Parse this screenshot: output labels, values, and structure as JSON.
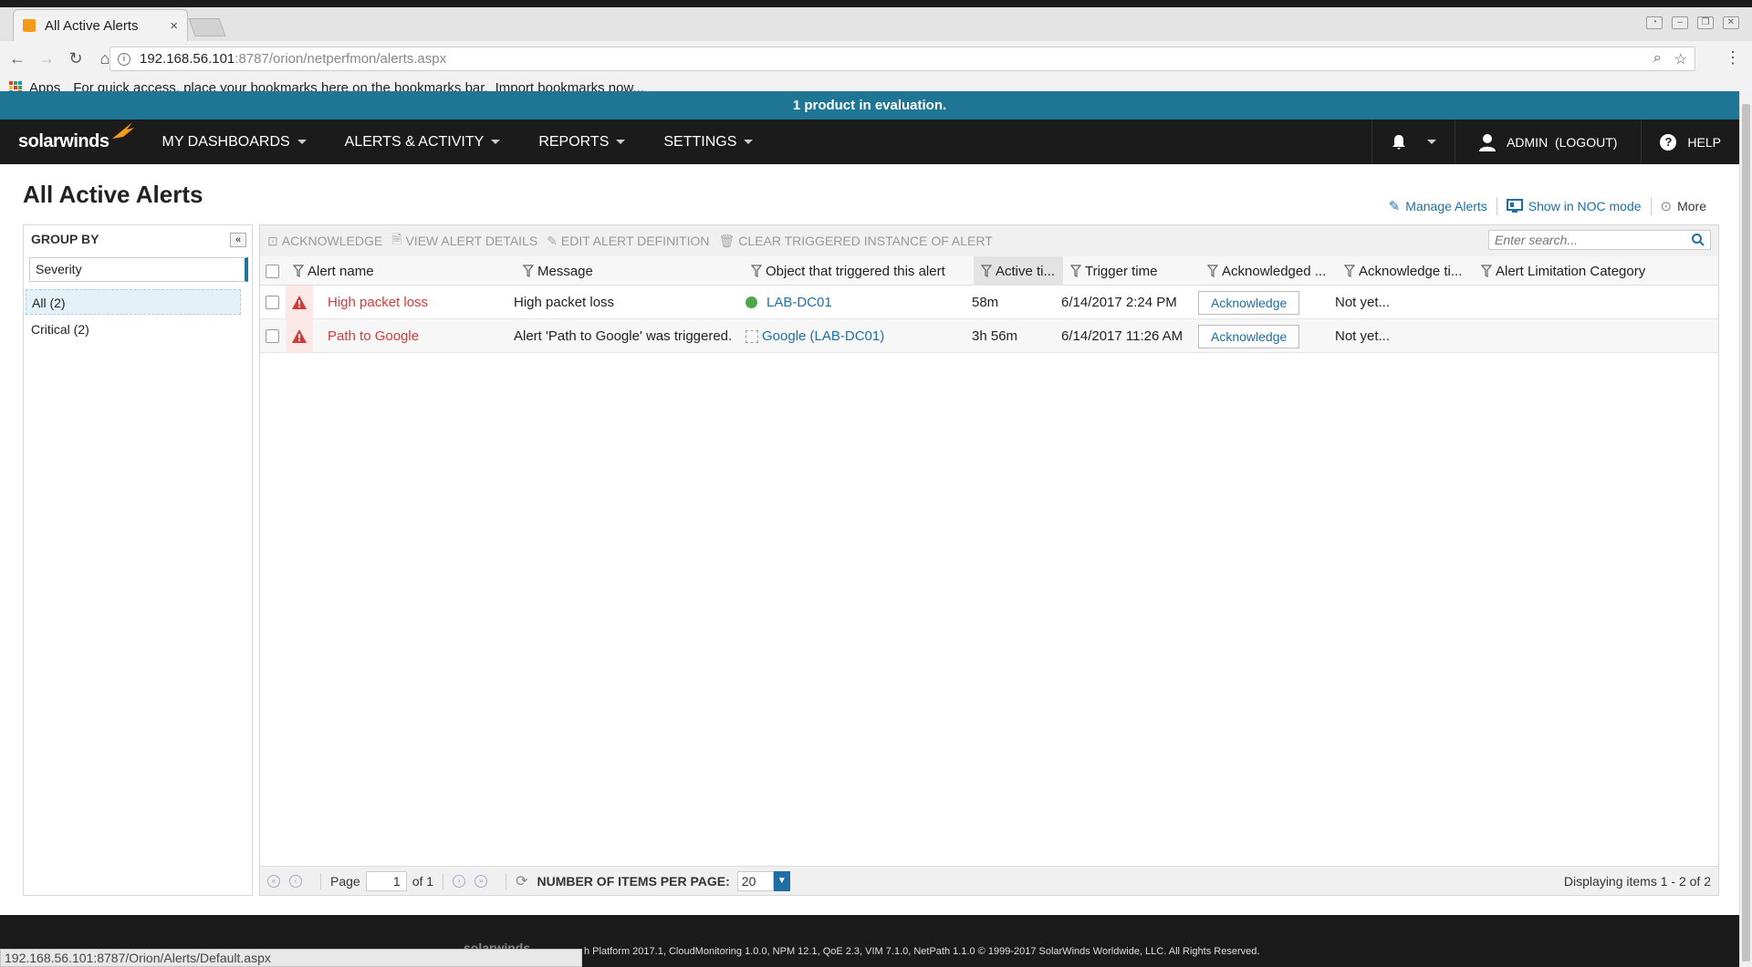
{
  "browser": {
    "tab_title": "All Active Alerts",
    "tab_close": "×",
    "url_host": "192.168.56.101",
    "url_path": ":8787/orion/netperfmon/alerts.aspx",
    "bookmarks_apps": "Apps",
    "bookmarks_hint": "For quick access, place your bookmarks here on the bookmarks bar.",
    "bookmarks_import": "Import bookmarks now...",
    "status_url": "192.168.56.101:8787/Orion/Alerts/Default.aspx"
  },
  "eval_banner": "1 product in evaluation.",
  "nav": {
    "logo": "solarwinds",
    "items": [
      {
        "label": "MY DASHBOARDS"
      },
      {
        "label": "ALERTS & ACTIVITY"
      },
      {
        "label": "REPORTS"
      },
      {
        "label": "SETTINGS"
      }
    ],
    "user": "ADMIN",
    "logout": "(LOGOUT)",
    "help": "HELP"
  },
  "page": {
    "title": "All Active Alerts",
    "actions": {
      "manage": "Manage Alerts",
      "noc": "Show in NOC mode",
      "more": "More"
    }
  },
  "groupby": {
    "title": "GROUP BY",
    "selected": "Severity",
    "items": [
      {
        "label": "All (2)"
      },
      {
        "label": "Critical (2)"
      }
    ]
  },
  "toolbar": {
    "acknowledge": "ACKNOWLEDGE",
    "view_details": "VIEW ALERT DETAILS",
    "edit_definition": "EDIT ALERT DEFINITION",
    "clear_instance": "CLEAR TRIGGERED INSTANCE OF ALERT",
    "search_placeholder": "Enter search..."
  },
  "columns": {
    "alert_name": "Alert name",
    "message": "Message",
    "object": "Object that triggered this alert",
    "active_time": "Active ti...",
    "trigger_time": "Trigger time",
    "acknowledged_by": "Acknowledged ...",
    "acknowledge_time": "Acknowledge ti...",
    "limitation": "Alert Limitation Category"
  },
  "rows": [
    {
      "name": "High packet loss",
      "message": "High packet loss",
      "object": "LAB-DC01",
      "active": "58m",
      "trigger": "6/14/2017 2:24 PM",
      "ack_button": "Acknowledge",
      "ack_time": "Not yet..."
    },
    {
      "name": "Path to Google",
      "message": "Alert 'Path to Google' was triggered.",
      "object": "Google (LAB-DC01)",
      "active": "3h 56m",
      "trigger": "6/14/2017 11:26 AM",
      "ack_button": "Acknowledge",
      "ack_time": "Not yet..."
    }
  ],
  "pager": {
    "page_label": "Page",
    "page_value": "1",
    "of_label": "of 1",
    "ipp_label": "NUMBER OF ITEMS PER PAGE:",
    "ipp_value": "20",
    "displaying": "Displaying items 1 - 2 of 2"
  },
  "footer": {
    "logo": "solarwinds",
    "text": "h Platform 2017.1, CloudMonitoring 1.0.0, NPM 12.1, QoE 2.3, VIM 7.1.0, NetPath 1.1.0 © 1999-2017 SolarWinds Worldwide, LLC. All Rights Reserved."
  },
  "colors": {
    "eval_bar": "#1f7694",
    "nav_bg": "#1b1b1b",
    "alert_red": "#d53a3a",
    "link_blue": "#1f6fa4",
    "status_up": "#4ea84a"
  }
}
